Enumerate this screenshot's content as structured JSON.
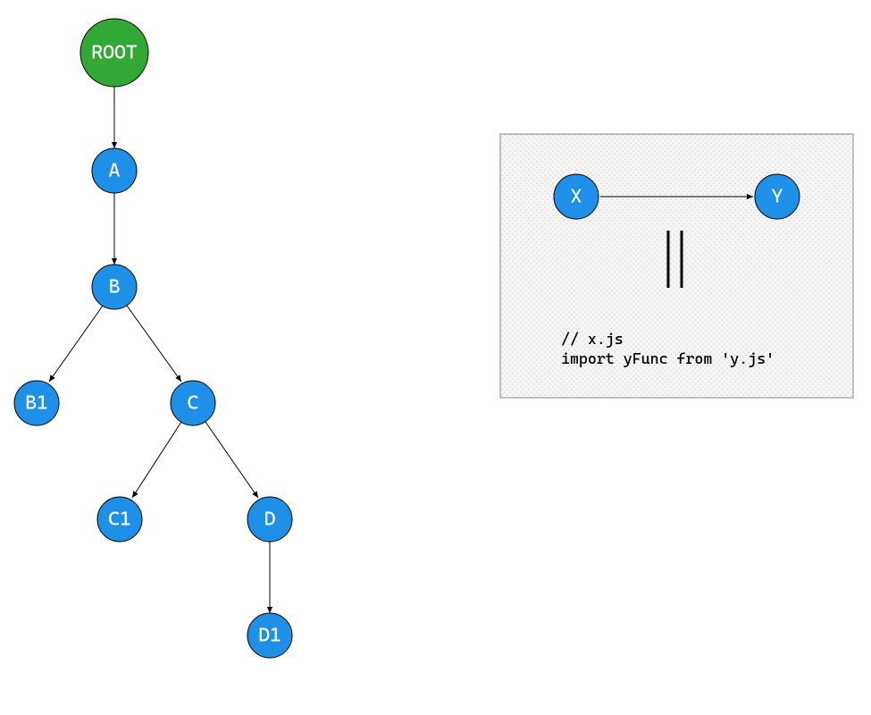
{
  "diagram": {
    "tree": {
      "nodes": {
        "root": {
          "label": "ROOT",
          "color": "#32a836",
          "r": 38
        },
        "a": {
          "label": "A",
          "color": "#1e90e7",
          "r": 25
        },
        "b": {
          "label": "B",
          "color": "#1e90e7",
          "r": 25
        },
        "b1": {
          "label": "B1",
          "color": "#1e90e7",
          "r": 25
        },
        "c": {
          "label": "C",
          "color": "#1e90e7",
          "r": 25
        },
        "c1": {
          "label": "C1",
          "color": "#1e90e7",
          "r": 25
        },
        "d": {
          "label": "D",
          "color": "#1e90e7",
          "r": 25
        },
        "d1": {
          "label": "D1",
          "color": "#1e90e7",
          "r": 25
        }
      },
      "edges": [
        [
          "root",
          "a"
        ],
        [
          "a",
          "b"
        ],
        [
          "b",
          "b1"
        ],
        [
          "b",
          "c"
        ],
        [
          "c",
          "c1"
        ],
        [
          "c",
          "d"
        ],
        [
          "d",
          "d1"
        ]
      ]
    },
    "legend": {
      "nodes": {
        "x": {
          "label": "X",
          "color": "#1e90e7",
          "r": 25
        },
        "y": {
          "label": "Y",
          "color": "#1e90e7",
          "r": 25
        }
      },
      "edge": [
        "x",
        "y"
      ],
      "code": "// x.js\nimport yFunc from 'y.js'"
    }
  }
}
